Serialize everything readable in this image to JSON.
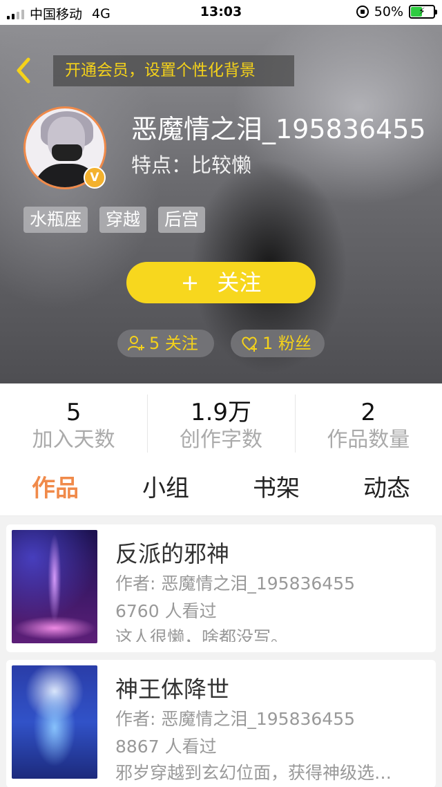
{
  "status_bar": {
    "carrier": "中国移动",
    "network": "4G",
    "time": "13:03",
    "battery": "50%",
    "battery_level": 0.5
  },
  "header": {
    "vip_banner": "开通会员，设置个性化背景"
  },
  "profile": {
    "username": "恶魔情之泪_195836455",
    "trait": "特点：比较懒",
    "vip_badge": "V",
    "tags": [
      "水瓶座",
      "穿越",
      "后宫"
    ],
    "follow_button": "关注",
    "follow_plus": "+",
    "following_label": "5 关注",
    "fans_label": "1 粉丝"
  },
  "stats": [
    {
      "value": "5",
      "label": "加入天数"
    },
    {
      "value": "1.9万",
      "label": "创作字数"
    },
    {
      "value": "2",
      "label": "作品数量"
    }
  ],
  "tabs": [
    "作品",
    "小组",
    "书架",
    "动态"
  ],
  "active_tab": "作品",
  "works": [
    {
      "title": "反派的邪神",
      "author": "作者: 恶魔情之泪_195836455",
      "views": "6760 人看过",
      "description": "这人很懒，啥都没写。"
    },
    {
      "title": "神王体降世",
      "author": "作者: 恶魔情之泪_195836455",
      "views": "8867 人看过",
      "description": "邪岁穿越到玄幻位面，获得神级选…"
    }
  ],
  "colors": {
    "accent_orange": "#f08a4a",
    "accent_yellow": "#f7d71e",
    "banner_text": "#f5d21a"
  }
}
